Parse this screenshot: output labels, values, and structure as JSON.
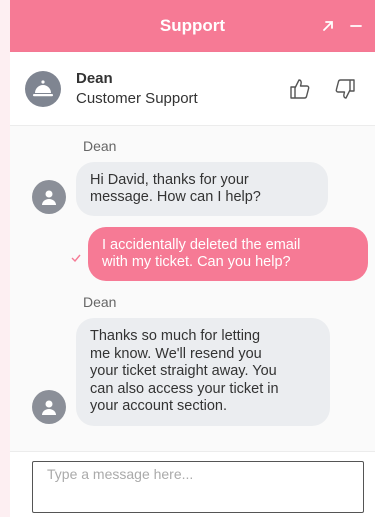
{
  "header": {
    "title": "Support"
  },
  "agent": {
    "name": "Dean",
    "role": "Customer Support"
  },
  "messages": [
    {
      "from": "agent",
      "sender": "Dean",
      "lines": [
        "Hi David, thanks for your",
        "message. How can I help?"
      ]
    },
    {
      "from": "user",
      "lines": [
        "I accidentally deleted the email",
        "with my ticket. Can you help?"
      ]
    },
    {
      "from": "agent",
      "sender": "Dean",
      "lines": [
        "Thanks so much for letting",
        "me know. We'll resend you",
        "your ticket straight away. You",
        "can also access your ticket in",
        "your account section."
      ]
    }
  ],
  "composer": {
    "placeholder": "Type a message here..."
  },
  "colors": {
    "accent": "#f67a95",
    "bubble_in": "#ebedf0",
    "avatar": "#8b8f98"
  }
}
